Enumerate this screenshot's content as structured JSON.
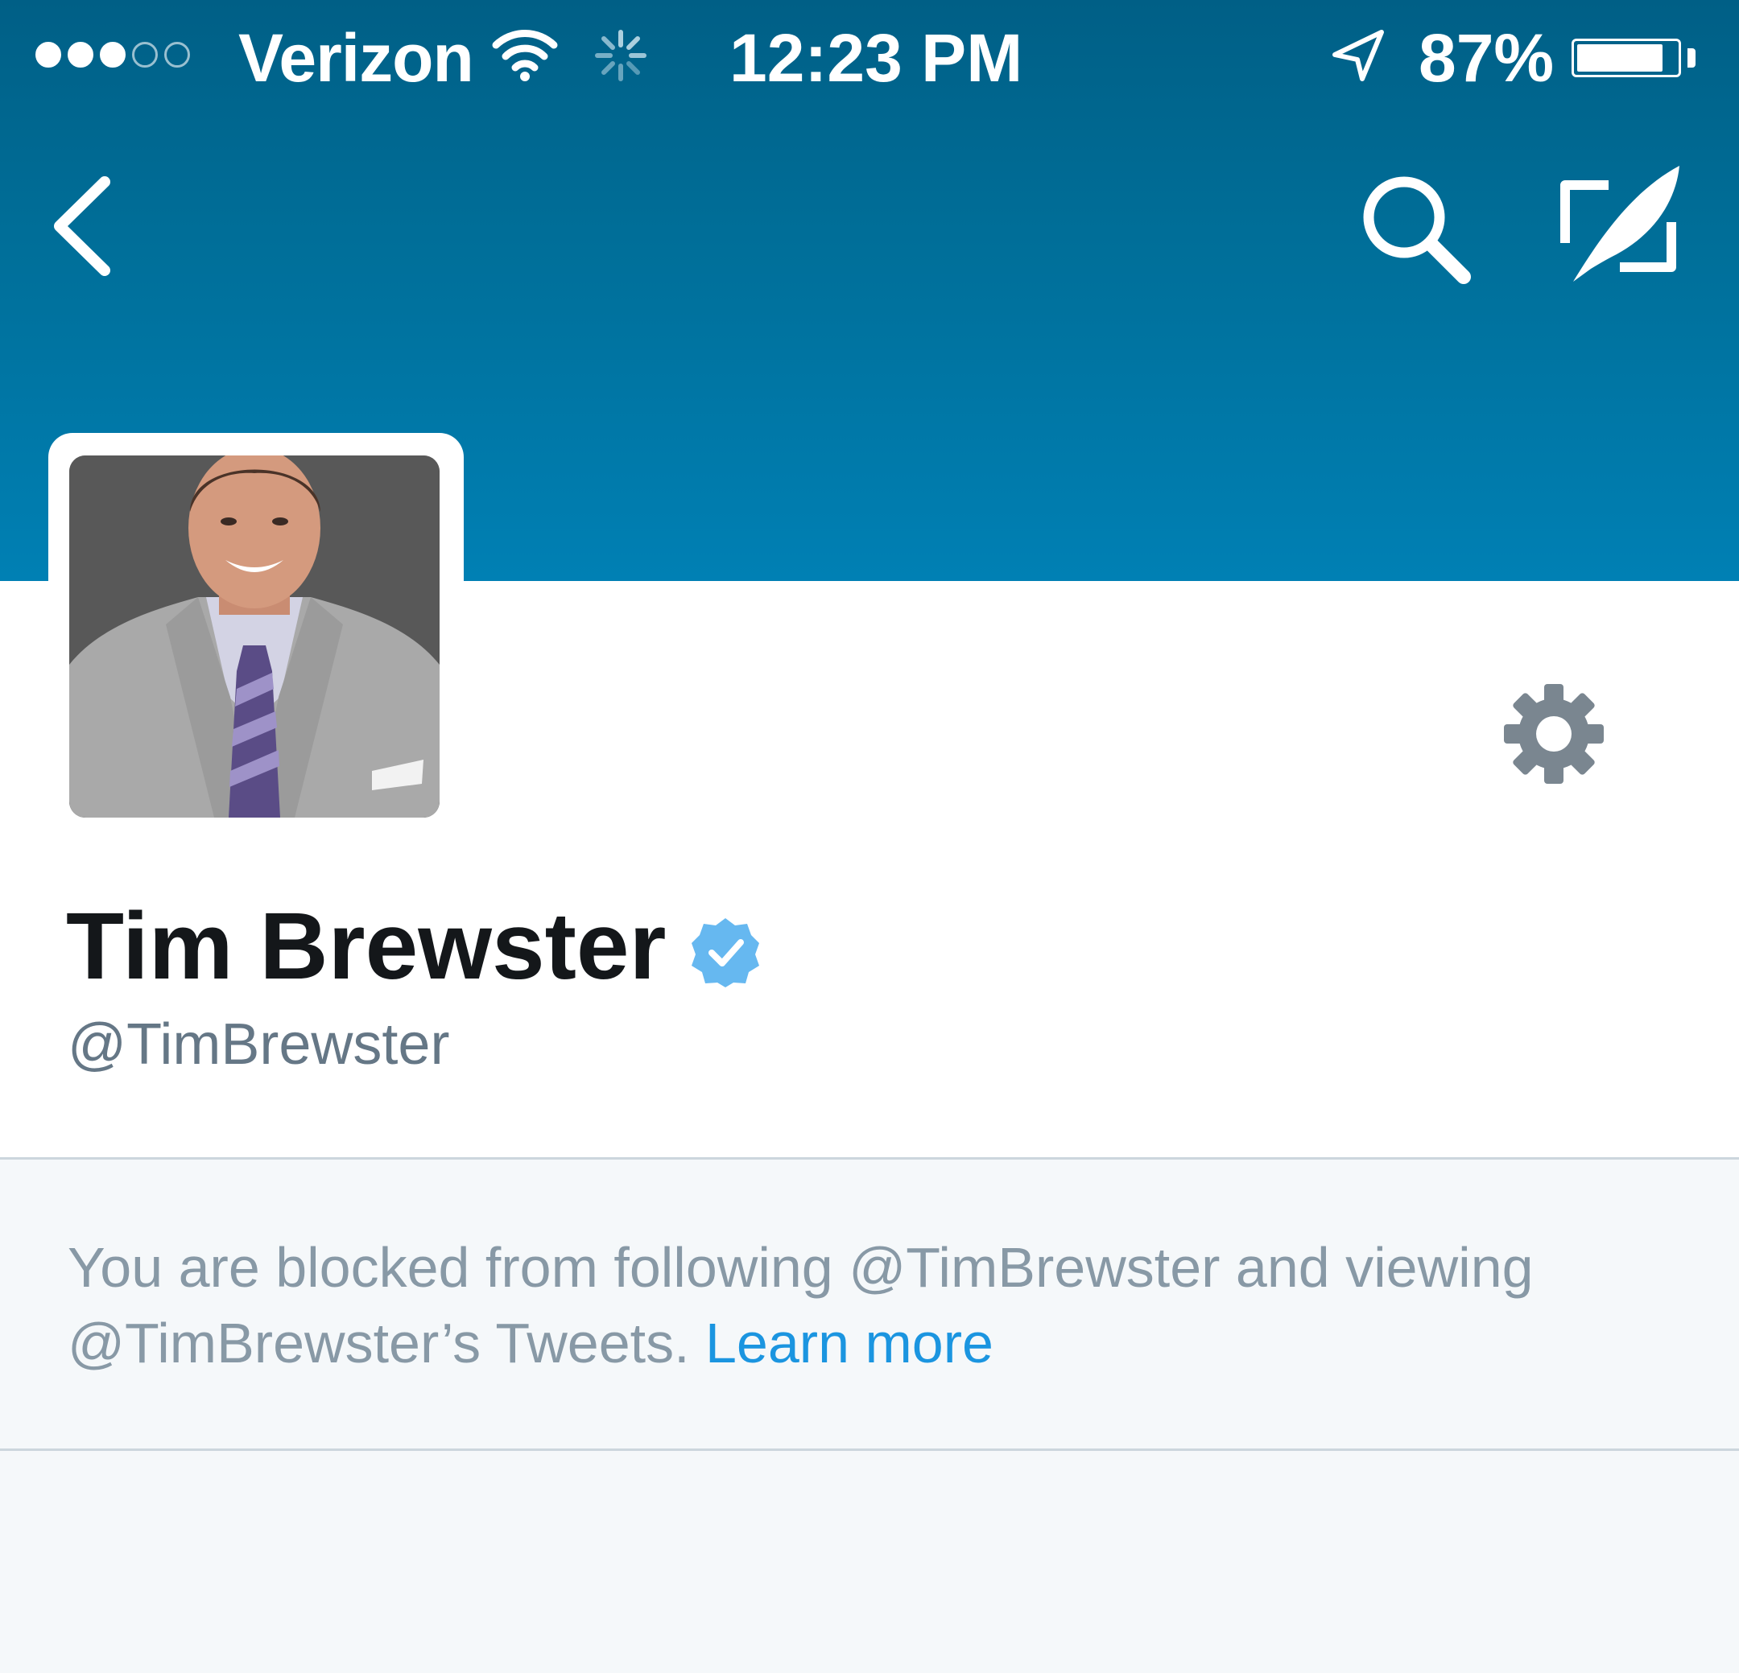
{
  "status_bar": {
    "carrier": "Verizon",
    "time": "12:23 PM",
    "battery_percent": "87%",
    "battery_level": 0.87,
    "signal_bars_filled": 3,
    "signal_bars_total": 5
  },
  "nav": {
    "back_icon": "chevron-left-icon",
    "search_icon": "search-icon",
    "compose_icon": "compose-tweet-icon"
  },
  "profile": {
    "display_name": "Tim Brewster",
    "handle": "@TimBrewster",
    "verified": true,
    "settings_icon": "gear-icon"
  },
  "notice": {
    "text": "You are blocked from following @TimBrewster and viewing @TimBrewster’s Tweets.",
    "link_label": "Learn more"
  },
  "colors": {
    "header_top": "#005f86",
    "header_bottom": "#0080b4",
    "link": "#1b95e0",
    "verified_badge": "#66b8f0",
    "muted_text": "#8899a6",
    "background": "#f5f8fa"
  }
}
